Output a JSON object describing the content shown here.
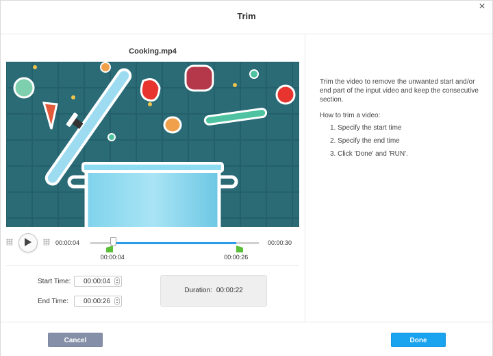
{
  "window": {
    "title": "Trim",
    "close_glyph": "×"
  },
  "video": {
    "filename": "Cooking.mp4"
  },
  "player": {
    "current_time": "00:00:04",
    "total_time": "00:00:30",
    "start_marker_time": "00:00:04",
    "end_marker_time": "00:00:26",
    "start_fraction": 0.1333,
    "end_fraction": 0.8667,
    "playhead_fraction": 0.1333,
    "accent_color": "#2a9ce8",
    "marker_color": "#5cbf3a"
  },
  "trim": {
    "start_label": "Start Time:",
    "start_value": "00:00:04",
    "end_label": "End Time:",
    "end_value": "00:00:26",
    "duration_label": "Duration:",
    "duration_value": "00:00:22"
  },
  "help": {
    "description": "Trim the video to remove the unwanted start and/or end part of the input video and keep the consecutive section.",
    "howto_title": "How to trim a video:",
    "steps": [
      "1. Specify the start time",
      "2. Specify the end time",
      "3. Click 'Done' and 'RUN'."
    ]
  },
  "footer": {
    "cancel_label": "Cancel",
    "done_label": "Done"
  },
  "icons": {
    "close": "close-icon",
    "play": "play-icon",
    "grip": "grip-icon",
    "start_marker": "start-marker-icon",
    "end_marker": "end-marker-icon"
  }
}
